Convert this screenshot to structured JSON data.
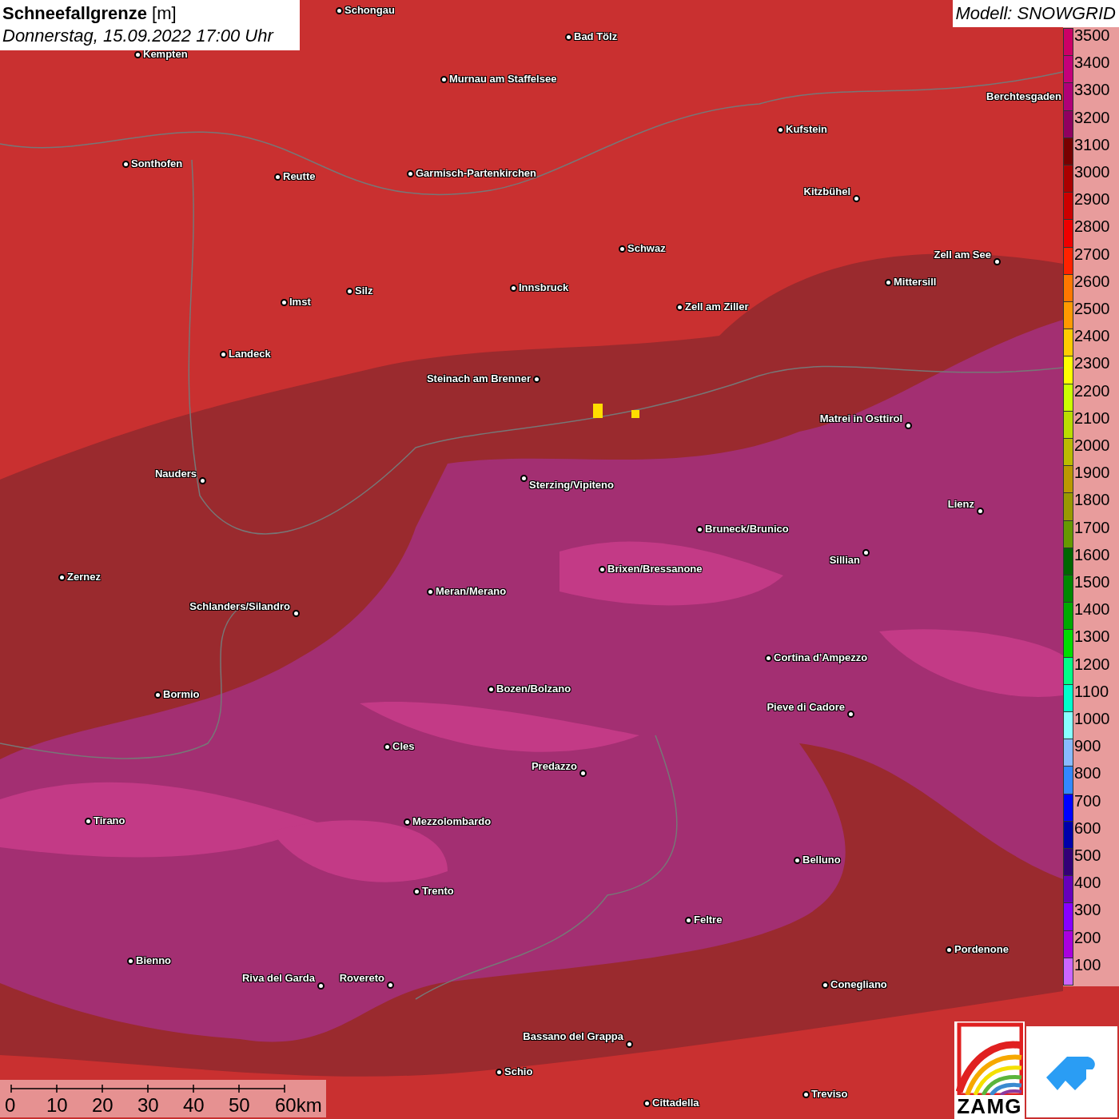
{
  "title": {
    "heading": "Schneefallgrenze",
    "unit": "[m]",
    "date": "Donnerstag, 15.09.2022 17:00 Uhr"
  },
  "model": "Modell: SNOWGRID",
  "legend": [
    {
      "label": "3500",
      "color": "#cc0066"
    },
    {
      "label": "3400",
      "color": "#c4007a"
    },
    {
      "label": "3300",
      "color": "#b00078"
    },
    {
      "label": "3200",
      "color": "#900060"
    },
    {
      "label": "3100",
      "color": "#770000"
    },
    {
      "label": "3000",
      "color": "#aa0000"
    },
    {
      "label": "2900",
      "color": "#cc0000"
    },
    {
      "label": "2800",
      "color": "#ee0000"
    },
    {
      "label": "2700",
      "color": "#ff2200"
    },
    {
      "label": "2600",
      "color": "#ff7700"
    },
    {
      "label": "2500",
      "color": "#ff9900"
    },
    {
      "label": "2400",
      "color": "#ffcc00"
    },
    {
      "label": "2300",
      "color": "#ffff00"
    },
    {
      "label": "2200",
      "color": "#ccff00"
    },
    {
      "label": "2100",
      "color": "#bbdd00"
    },
    {
      "label": "2000",
      "color": "#bbbb00"
    },
    {
      "label": "1900",
      "color": "#bb9900"
    },
    {
      "label": "1800",
      "color": "#999900"
    },
    {
      "label": "1700",
      "color": "#669900"
    },
    {
      "label": "1600",
      "color": "#006600"
    },
    {
      "label": "1500",
      "color": "#008800"
    },
    {
      "label": "1400",
      "color": "#00aa00"
    },
    {
      "label": "1300",
      "color": "#00dd00"
    },
    {
      "label": "1200",
      "color": "#00ff88"
    },
    {
      "label": "1100",
      "color": "#00ffcc"
    },
    {
      "label": "1000",
      "color": "#88ffff"
    },
    {
      "label": "900",
      "color": "#88bbff"
    },
    {
      "label": "800",
      "color": "#3388ff"
    },
    {
      "label": "700",
      "color": "#0000ff"
    },
    {
      "label": "600",
      "color": "#0000aa"
    },
    {
      "label": "500",
      "color": "#330077"
    },
    {
      "label": "400",
      "color": "#6600bb"
    },
    {
      "label": "300",
      "color": "#8800ff"
    },
    {
      "label": "200",
      "color": "#aa00dd"
    },
    {
      "label": "100",
      "color": "#cc66ff"
    }
  ],
  "scale_bar": [
    "0",
    "10",
    "20",
    "30",
    "40",
    "50",
    "60km"
  ],
  "logo_text": "ZAMG",
  "cities": [
    "Schongau",
    "Bad Tölz",
    "Kempten",
    "Murnau am Staffelsee",
    "Berchtesgaden",
    "Kufstein",
    "Sonthofen",
    "Reutte",
    "Garmisch-Partenkirchen",
    "Kitzbühel",
    "Schwaz",
    "Zell am See",
    "Mittersill",
    "Innsbruck",
    "Zell am Ziller",
    "Imst",
    "Silz",
    "Landeck",
    "Steinach am Brenner",
    "Matrei in Osttirol",
    "Nauders",
    "Sterzing/Vipiteno",
    "Lienz",
    "Bruneck/Brunico",
    "Sillian",
    "Zernez",
    "Brixen/Bressanone",
    "Meran/Merano",
    "Schlanders/Silandro",
    "Cortina d'Ampezzo",
    "Bozen/Bolzano",
    "Bormio",
    "Pieve di Cadore",
    "Cles",
    "Predazzo",
    "Tirano",
    "Mezzolombardo",
    "Belluno",
    "Trento",
    "Feltre",
    "Pordenone",
    "Bienno",
    "Riva del Garda",
    "Rovereto",
    "Conegliano",
    "Bassano del Grappa",
    "Schio",
    "Treviso",
    "Cittadella"
  ]
}
